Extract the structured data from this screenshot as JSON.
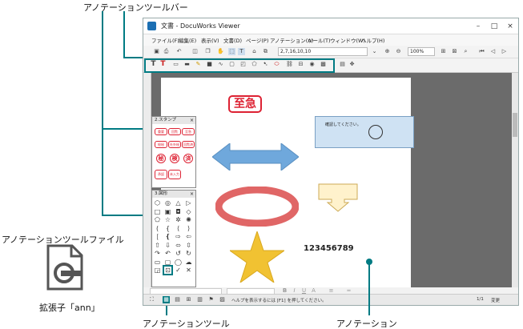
{
  "callouts": {
    "toolbar": "アノテーションツールバー",
    "file": "アノテーションツールファイル",
    "extension": "拡張子「ann」",
    "tool": "アノテーションツール",
    "annotation": "アノテーション"
  },
  "window": {
    "title": "文書 - DocuWorks Viewer",
    "menu": [
      "ファイル(F)",
      "編集(E)",
      "表示(V)",
      "文書(D)",
      "ページ(P)",
      "アノテーション(A)",
      "ツール(T)",
      "ウィンドウ(W)",
      "ヘルプ(H)"
    ],
    "page_field": "2,7,16,10,10",
    "zoom": "100%"
  },
  "palettes": {
    "stamp_title": "2.スタンプ",
    "shape_title": "3.図形",
    "stamps": [
      "重要",
      "回覧",
      "至急",
      "極秘",
      "社外秘",
      "回覧済",
      "検",
      "済"
    ],
    "stamp_tall": [
      "承認",
      "未入力"
    ]
  },
  "page_content": {
    "stamp_big": "至急",
    "note_text": "確認してください。",
    "number_text": "123456789"
  },
  "statusbar": {
    "help": "ヘルプを表示するには [F1] を押してください。",
    "page": "1/1",
    "mode": "変更"
  },
  "colors": {
    "accent": "#007b83",
    "arrow": "#6fa8dc",
    "ring": "#e06666",
    "star": "#f1c232",
    "note": "#cfe2f3"
  }
}
